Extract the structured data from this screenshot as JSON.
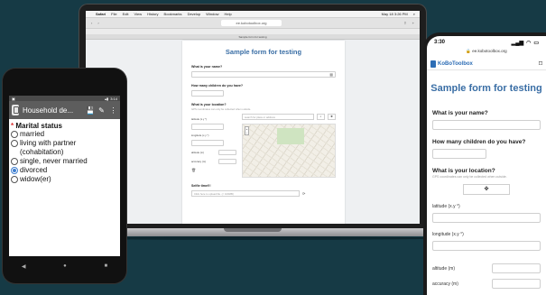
{
  "laptop": {
    "menu": {
      "app": "Safari",
      "items": [
        "File",
        "Edit",
        "View",
        "History",
        "Bookmarks",
        "Develop",
        "Window",
        "Help"
      ],
      "clock": "May 18  3:26 PM"
    },
    "url": "ee.kobotoolbox.org",
    "tab_label": "Sample form for testing",
    "form": {
      "title": "Sample form for testing",
      "q_name": "What is your name?",
      "q_children": "How many children do you have?",
      "q_location": "What is your location?",
      "q_location_hint": "GPS coordinates can only be collected when outside.",
      "lat_label": "latitude (x.y °)",
      "lon_label": "longitude (x.y °)",
      "alt_label": "altitude (m)",
      "acc_label": "accuracy (m)",
      "map_search_placeholder": "search for place or address",
      "q_selfie": "Selfie time!!!",
      "file_placeholder": "Click here to upload file. (< 100MB)"
    }
  },
  "android": {
    "status_time": "3:14",
    "title": "Household de...",
    "question": "Marital status",
    "required_mark": "*",
    "options": [
      {
        "label": "married",
        "selected": false
      },
      {
        "label": "living with partner (cohabitation)",
        "selected": false
      },
      {
        "label": "single, never married",
        "selected": false
      },
      {
        "label": "divorced",
        "selected": true
      },
      {
        "label": "widow(er)",
        "selected": false
      }
    ],
    "nav": [
      "◀",
      "●",
      "■"
    ]
  },
  "iphone": {
    "status_time": "3:30",
    "url": "ee.kobotoolbox.org",
    "brand": "KoBoToolbox",
    "form": {
      "title": "Sample form for testing",
      "q_name": "What is your name?",
      "q_children": "How many children do you have?",
      "q_location": "What is your location?",
      "q_location_hint": "GPS coordinates can only be collected when outside.",
      "lat_label": "latitude (x.y °)",
      "lon_label": "longitude (x.y °)",
      "alt_label": "altitude (m)",
      "acc_label": "accuracy (m)"
    }
  }
}
